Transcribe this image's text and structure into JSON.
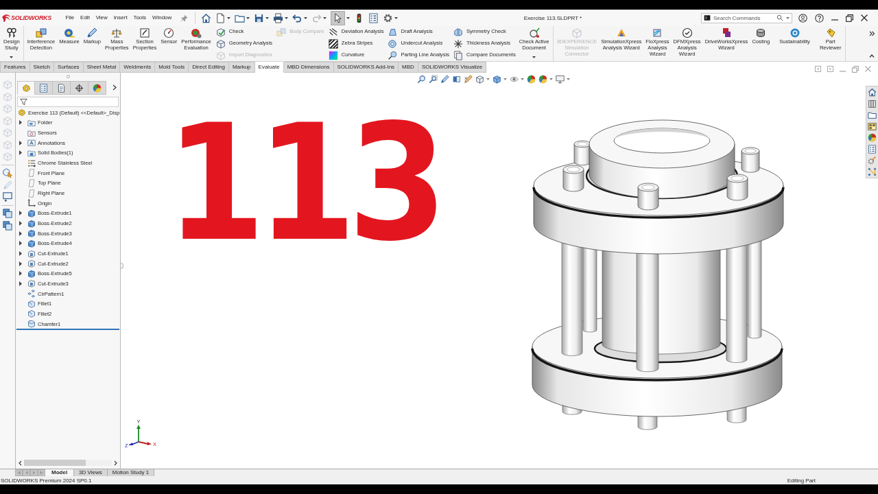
{
  "window": {
    "app_name": "SOLIDWORKS",
    "title": "Exercise 113.SLDPRT *"
  },
  "menu": [
    "File",
    "Edit",
    "View",
    "Insert",
    "Tools",
    "Window"
  ],
  "quick_access": {
    "redo_disabled": true,
    "select_active": true
  },
  "search": {
    "placeholder": "Search Commands"
  },
  "ribbon": {
    "groups": [
      [
        {
          "kind": "large",
          "label": "Design\nStudy",
          "disabled": false,
          "dropdown": true
        }
      ],
      [
        {
          "kind": "large",
          "label": "Interference\nDetection",
          "disabled": false,
          "dropdown": false
        },
        {
          "kind": "large",
          "label": "Measure",
          "disabled": false,
          "dropdown": false
        },
        {
          "kind": "large",
          "label": "Markup",
          "disabled": false,
          "dropdown": false
        },
        {
          "kind": "large",
          "label": "Mass\nProperties",
          "disabled": false,
          "dropdown": false
        },
        {
          "kind": "large",
          "label": "Section\nProperties",
          "disabled": false,
          "dropdown": false
        },
        {
          "kind": "large",
          "label": "Sensor",
          "disabled": false,
          "dropdown": false
        },
        {
          "kind": "large",
          "label": "Performance\nEvaluation",
          "disabled": false,
          "dropdown": false
        },
        {
          "kind": "stack",
          "items": [
            {
              "label": "Check",
              "disabled": false
            },
            {
              "label": "Geometry Analysis",
              "disabled": false
            },
            {
              "label": "Import Diagnostics",
              "disabled": true
            }
          ]
        },
        {
          "kind": "stack",
          "items": [
            {
              "label": "Body Compare",
              "disabled": true
            }
          ]
        },
        {
          "kind": "stack",
          "items": [
            {
              "label": "Deviation Analysis",
              "disabled": false
            },
            {
              "label": "Zebra Stripes",
              "disabled": false
            },
            {
              "label": "Curvature",
              "disabled": false
            }
          ]
        },
        {
          "kind": "stack",
          "items": [
            {
              "label": "Draft Analysis",
              "disabled": false
            },
            {
              "label": "Undercut Analysis",
              "disabled": false
            },
            {
              "label": "Parting Line Analysis",
              "disabled": false
            }
          ]
        },
        {
          "kind": "stack",
          "items": [
            {
              "label": "Symmetry Check",
              "disabled": false
            },
            {
              "label": "Thickness Analysis",
              "disabled": false
            },
            {
              "label": "Compare Documents",
              "disabled": false
            }
          ]
        },
        {
          "kind": "large",
          "label": "Check Active\nDocument",
          "disabled": false,
          "dropdown": true
        }
      ],
      [
        {
          "kind": "large",
          "label": "3DEXPERIENCE\nSimulation\nConnector",
          "disabled": true,
          "dropdown": false
        },
        {
          "kind": "large",
          "label": "SimulationXpress\nAnalysis Wizard",
          "disabled": false,
          "dropdown": false
        },
        {
          "kind": "large",
          "label": "FloXpress\nAnalysis\nWizard",
          "disabled": false,
          "dropdown": false
        },
        {
          "kind": "large",
          "label": "DFMXpress\nAnalysis\nWizard",
          "disabled": false,
          "dropdown": false
        },
        {
          "kind": "large",
          "label": "DriveWorksXpress\nWizard",
          "disabled": false,
          "dropdown": false
        },
        {
          "kind": "large",
          "label": "Costing",
          "disabled": false,
          "dropdown": false
        },
        {
          "kind": "large",
          "label": "Sustainability",
          "disabled": false,
          "dropdown": false
        },
        {
          "kind": "large",
          "label": "Part\nReviewer",
          "disabled": false,
          "dropdown": false
        }
      ]
    ]
  },
  "tabs": [
    {
      "label": "Features",
      "selected": false
    },
    {
      "label": "Sketch",
      "selected": false
    },
    {
      "label": "Surfaces",
      "selected": false
    },
    {
      "label": "Sheet Metal",
      "selected": false
    },
    {
      "label": "Weldments",
      "selected": false
    },
    {
      "label": "Mold Tools",
      "selected": false
    },
    {
      "label": "Direct Editing",
      "selected": false
    },
    {
      "label": "Markup",
      "selected": false
    },
    {
      "label": "Evaluate",
      "selected": true
    },
    {
      "label": "MBD Dimensions",
      "selected": false
    },
    {
      "label": "SOLIDWORKS Add-Ins",
      "selected": false
    },
    {
      "label": "MBD",
      "selected": false
    },
    {
      "label": "SOLIDWORKS Visualize",
      "selected": false
    }
  ],
  "side_toolbar": [
    {
      "disabled": true
    },
    {
      "disabled": true
    },
    {
      "disabled": true
    },
    {
      "disabled": true
    },
    {
      "disabled": true
    },
    {
      "disabled": true
    },
    {
      "disabled": true
    },
    {
      "disabled": false
    },
    {
      "disabled": true
    },
    {
      "disabled": false
    },
    {
      "disabled": false
    },
    {
      "disabled": false
    }
  ],
  "feature_tree": {
    "panel_tabs": [
      {
        "selected": true
      },
      {
        "selected": false
      },
      {
        "selected": false
      },
      {
        "selected": false
      },
      {
        "selected": false
      }
    ],
    "root": {
      "label": "Exercise 113 (Default) <<Default>_Disp",
      "kind": "part",
      "expandable": false,
      "children": [
        {
          "label": "Folder",
          "kind": "folder",
          "expandable": true
        },
        {
          "label": "Sensors",
          "kind": "sensors",
          "expandable": false
        },
        {
          "label": "Annotations",
          "kind": "annotations",
          "expandable": true
        },
        {
          "label": "Solid Bodies(1)",
          "kind": "bodies",
          "expandable": true
        },
        {
          "label": "Chrome Stainless Steel",
          "kind": "material",
          "expandable": false
        },
        {
          "label": "Front Plane",
          "kind": "plane",
          "expandable": false
        },
        {
          "label": "Top Plane",
          "kind": "plane",
          "expandable": false
        },
        {
          "label": "Right Plane",
          "kind": "plane",
          "expandable": false
        },
        {
          "label": "Origin",
          "kind": "origin",
          "expandable": false
        },
        {
          "label": "Boss-Extrude1",
          "kind": "boss",
          "expandable": true
        },
        {
          "label": "Boss-Extrude2",
          "kind": "boss",
          "expandable": true
        },
        {
          "label": "Boss-Extrude3",
          "kind": "boss",
          "expandable": true
        },
        {
          "label": "Boss-Extrude4",
          "kind": "boss",
          "expandable": true
        },
        {
          "label": "Cut-Extrude1",
          "kind": "cut",
          "expandable": true
        },
        {
          "label": "Cut-Extrude2",
          "kind": "cut",
          "expandable": true
        },
        {
          "label": "Boss-Extrude5",
          "kind": "boss",
          "expandable": true
        },
        {
          "label": "Cut-Extrude3",
          "kind": "cut",
          "expandable": true
        },
        {
          "label": "CirPattern1",
          "kind": "pattern",
          "expandable": false
        },
        {
          "label": "Fillet1",
          "kind": "fillet",
          "expandable": false
        },
        {
          "label": "Fillet2",
          "kind": "fillet",
          "expandable": false
        },
        {
          "label": "Chamfer1",
          "kind": "chamfer",
          "expandable": false
        }
      ]
    }
  },
  "graphics": {
    "note": "113",
    "axis_labels": [
      "Y",
      "X",
      "Z"
    ]
  },
  "bottom_tabs": [
    {
      "label": "Model",
      "selected": true
    },
    {
      "label": "3D Views",
      "selected": false
    },
    {
      "label": "Motion Study 1",
      "selected": false
    }
  ],
  "status_bar": {
    "product": "SOLIDWORKS Premium 2024 SP0.1",
    "mode": "Editing Part"
  }
}
